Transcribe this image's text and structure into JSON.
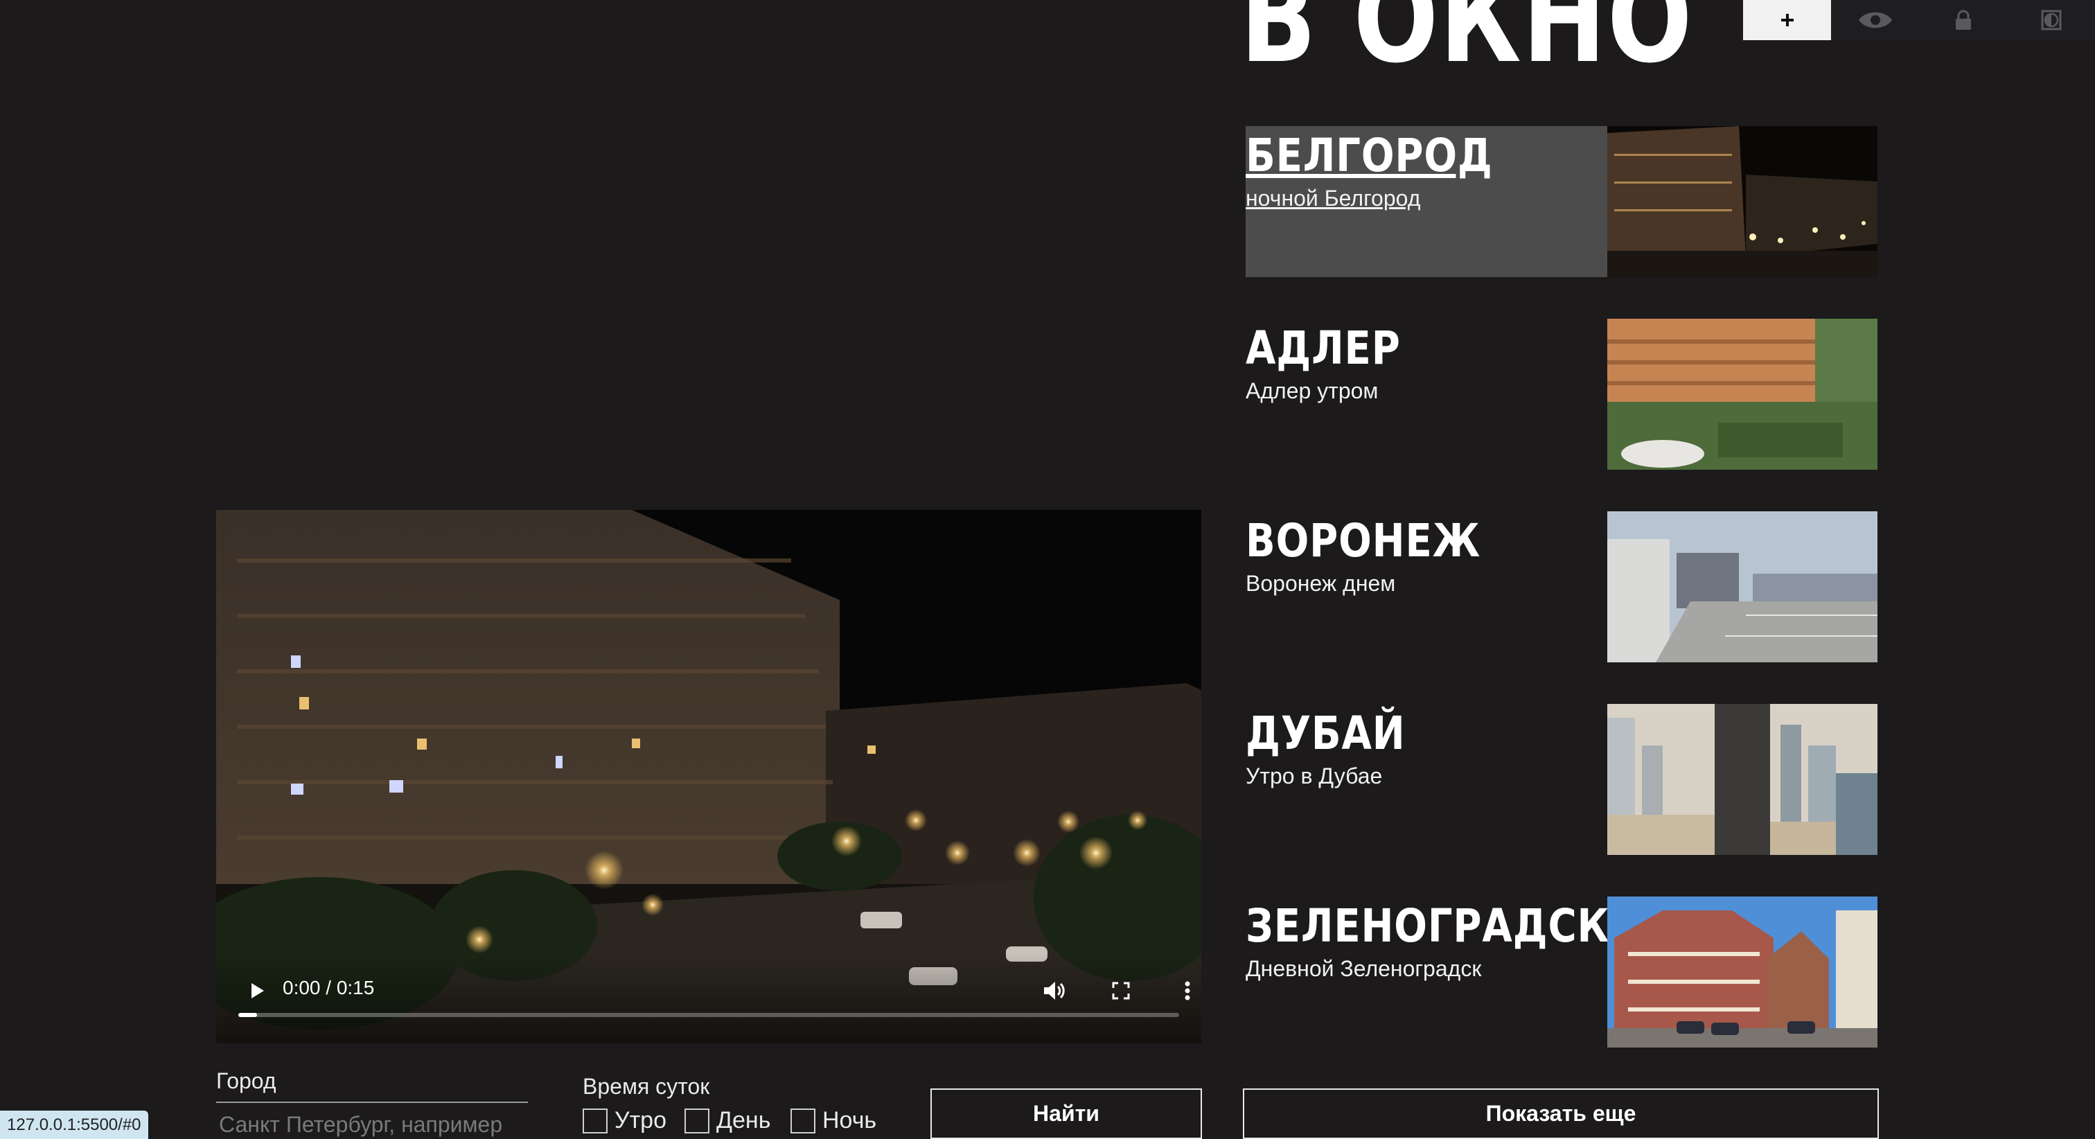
{
  "site": {
    "title": "В ОКНО"
  },
  "toolbar": {
    "items": [
      {
        "icon": "plus-icon",
        "glyph": "+"
      },
      {
        "icon": "eye-icon",
        "glyph": "👁"
      },
      {
        "icon": "lock-icon",
        "glyph": "🔒"
      },
      {
        "icon": "contrast-icon",
        "glyph": "◐"
      }
    ]
  },
  "player": {
    "time": "0:00 / 0:15",
    "progress": 0.02
  },
  "filters": {
    "city_label": "Город",
    "city_placeholder": "Санкт Петербург, например",
    "time_label": "Время суток",
    "options": [
      "Утро",
      "День",
      "Ночь"
    ],
    "find_button": "Найти"
  },
  "cities": [
    {
      "name": "БЕЛГОРОД",
      "subtitle": "ночной Белгород",
      "active": true
    },
    {
      "name": "АДЛЕР",
      "subtitle": "Адлер утром",
      "active": false
    },
    {
      "name": "ВОРОНЕЖ",
      "subtitle": "Воронеж днем",
      "active": false
    },
    {
      "name": "ДУБАЙ",
      "subtitle": "Утро в Дубае",
      "active": false
    },
    {
      "name": "ЗЕЛЕНОГРАДСК",
      "subtitle": "Дневной Зеленоградск",
      "active": false
    }
  ],
  "show_more_button": "Показать еще",
  "status_url": "127.0.0.1:5500/#0"
}
